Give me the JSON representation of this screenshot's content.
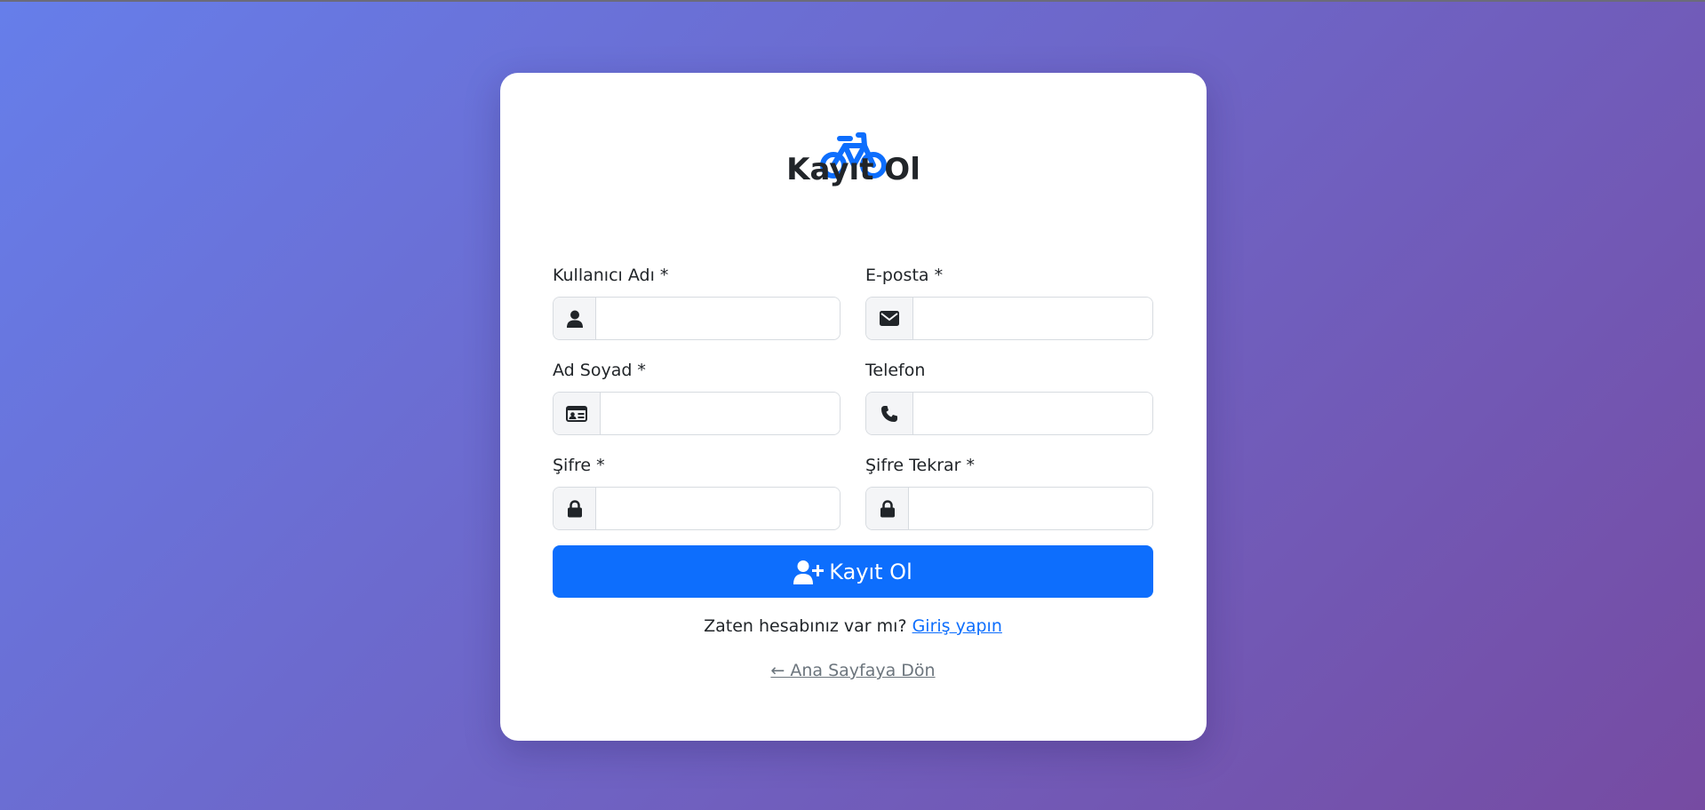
{
  "page": {
    "title": "Kayıt Ol",
    "logo_icon": "bicycle-icon",
    "accent_color": "#0d6efd",
    "background_gradient": [
      "#667eea",
      "#764ba2"
    ]
  },
  "form": {
    "fields": [
      {
        "label": "Kullanıcı Adı *",
        "icon": "user-icon",
        "value": "",
        "placeholder": ""
      },
      {
        "label": "E-posta *",
        "icon": "envelope-icon",
        "value": "",
        "placeholder": ""
      },
      {
        "label": "Ad Soyad *",
        "icon": "id-card-icon",
        "value": "",
        "placeholder": ""
      },
      {
        "label": "Telefon",
        "icon": "phone-icon",
        "value": "",
        "placeholder": ""
      },
      {
        "label": "Şifre *",
        "icon": "lock-icon",
        "value": "",
        "placeholder": ""
      },
      {
        "label": "Şifre Tekrar *",
        "icon": "lock-icon",
        "value": "",
        "placeholder": ""
      }
    ],
    "submit_label": "Kayıt Ol",
    "submit_icon": "user-plus-icon"
  },
  "footer": {
    "login_prompt": "Zaten hesabınız var mı?",
    "login_link": "Giriş yapın",
    "back_link": "← Ana Sayfaya Dön"
  }
}
